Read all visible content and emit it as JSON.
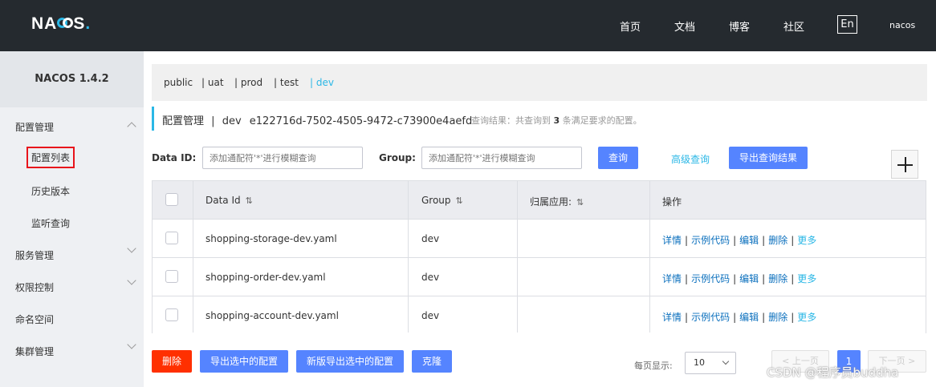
{
  "header": {
    "logo": "NACOS.",
    "logo_parts": {
      "na": "NA",
      "s": "S",
      "dot": "."
    },
    "nav": [
      "首页",
      "文档",
      "博客",
      "社区"
    ],
    "lang": "En",
    "user": "nacos"
  },
  "sidebar": {
    "version": "NACOS 1.4.2",
    "items": [
      {
        "label": "配置管理"
      },
      {
        "label": "配置列表"
      },
      {
        "label": "历史版本"
      },
      {
        "label": "监听查询"
      },
      {
        "label": "服务管理"
      },
      {
        "label": "权限控制"
      },
      {
        "label": "命名空间"
      },
      {
        "label": "集群管理"
      }
    ]
  },
  "namespaces": [
    {
      "label": "public"
    },
    {
      "label": "| uat"
    },
    {
      "label": "| prod"
    },
    {
      "label": "| test"
    },
    {
      "label": "| dev",
      "selected": true
    }
  ],
  "page": {
    "title": "配置管理",
    "divider": "|",
    "namespace": "dev",
    "namespace_id": "e122716d-7502-4505-9472-c73900e4aefd",
    "result_prefix": "查询结果：共查询到",
    "result_count": "3",
    "result_suffix": "条满足要求的配置。"
  },
  "search": {
    "data_id_label": "Data ID:",
    "data_id_placeholder": "添加通配符'*'进行模糊查询",
    "group_label": "Group:",
    "group_placeholder": "添加通配符'*'进行模糊查询",
    "query_button": "查询",
    "advanced_query": "高级查询",
    "export_button": "导出查询结果"
  },
  "table": {
    "columns": [
      "Data Id",
      "Group",
      "归属应用:",
      "操作"
    ],
    "sort_icon": "⇅",
    "rows": [
      {
        "data_id": "shopping-storage-dev.yaml",
        "group": "dev",
        "app": ""
      },
      {
        "data_id": "shopping-order-dev.yaml",
        "group": "dev",
        "app": ""
      },
      {
        "data_id": "shopping-account-dev.yaml",
        "group": "dev",
        "app": ""
      }
    ],
    "ops": {
      "detail": "详情",
      "sample": "示例代码",
      "edit": "编辑",
      "delete": "删除",
      "more": "更多",
      "sep": "|"
    }
  },
  "footer": {
    "delete": "删除",
    "export_selected": "导出选中的配置",
    "export_selected_new": "新版导出选中的配置",
    "clone": "克隆",
    "page_size_label": "每页显示:",
    "page_size": "10",
    "prev": "< 上一页",
    "current_page": "1",
    "next": "下一页 >"
  },
  "watermark": "CSDN @程序员buddha",
  "colors": {
    "topbar": "#252a2f",
    "accent": "#2ab7e6",
    "primary": "#5584ff",
    "danger": "#ff3000"
  }
}
